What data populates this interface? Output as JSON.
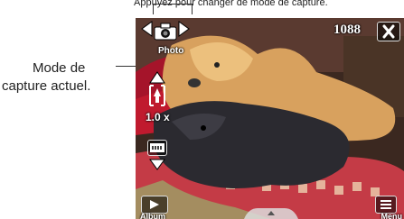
{
  "annotation": {
    "top_caption": "Appuyez pour changer de mode de capture.",
    "side_label_line1": "Mode de",
    "side_label_line2": "capture actuel."
  },
  "camera": {
    "capture_mode": "Photo",
    "remaining_shots": "1088",
    "zoom_level": "1.0 x",
    "album_label": "Album",
    "menu_label": "Menu"
  },
  "icons": {
    "mode_prev": "triangle-left-icon",
    "mode_current": "camera-icon",
    "mode_next": "triangle-right-icon",
    "close": "close-x-icon",
    "zoom_in": "zoom-up-arrow-icon",
    "zoom_out": "zoom-down-arrow-icon",
    "white_balance": "white-balance-icon",
    "album": "play-icon",
    "menu": "menu-list-icon"
  }
}
